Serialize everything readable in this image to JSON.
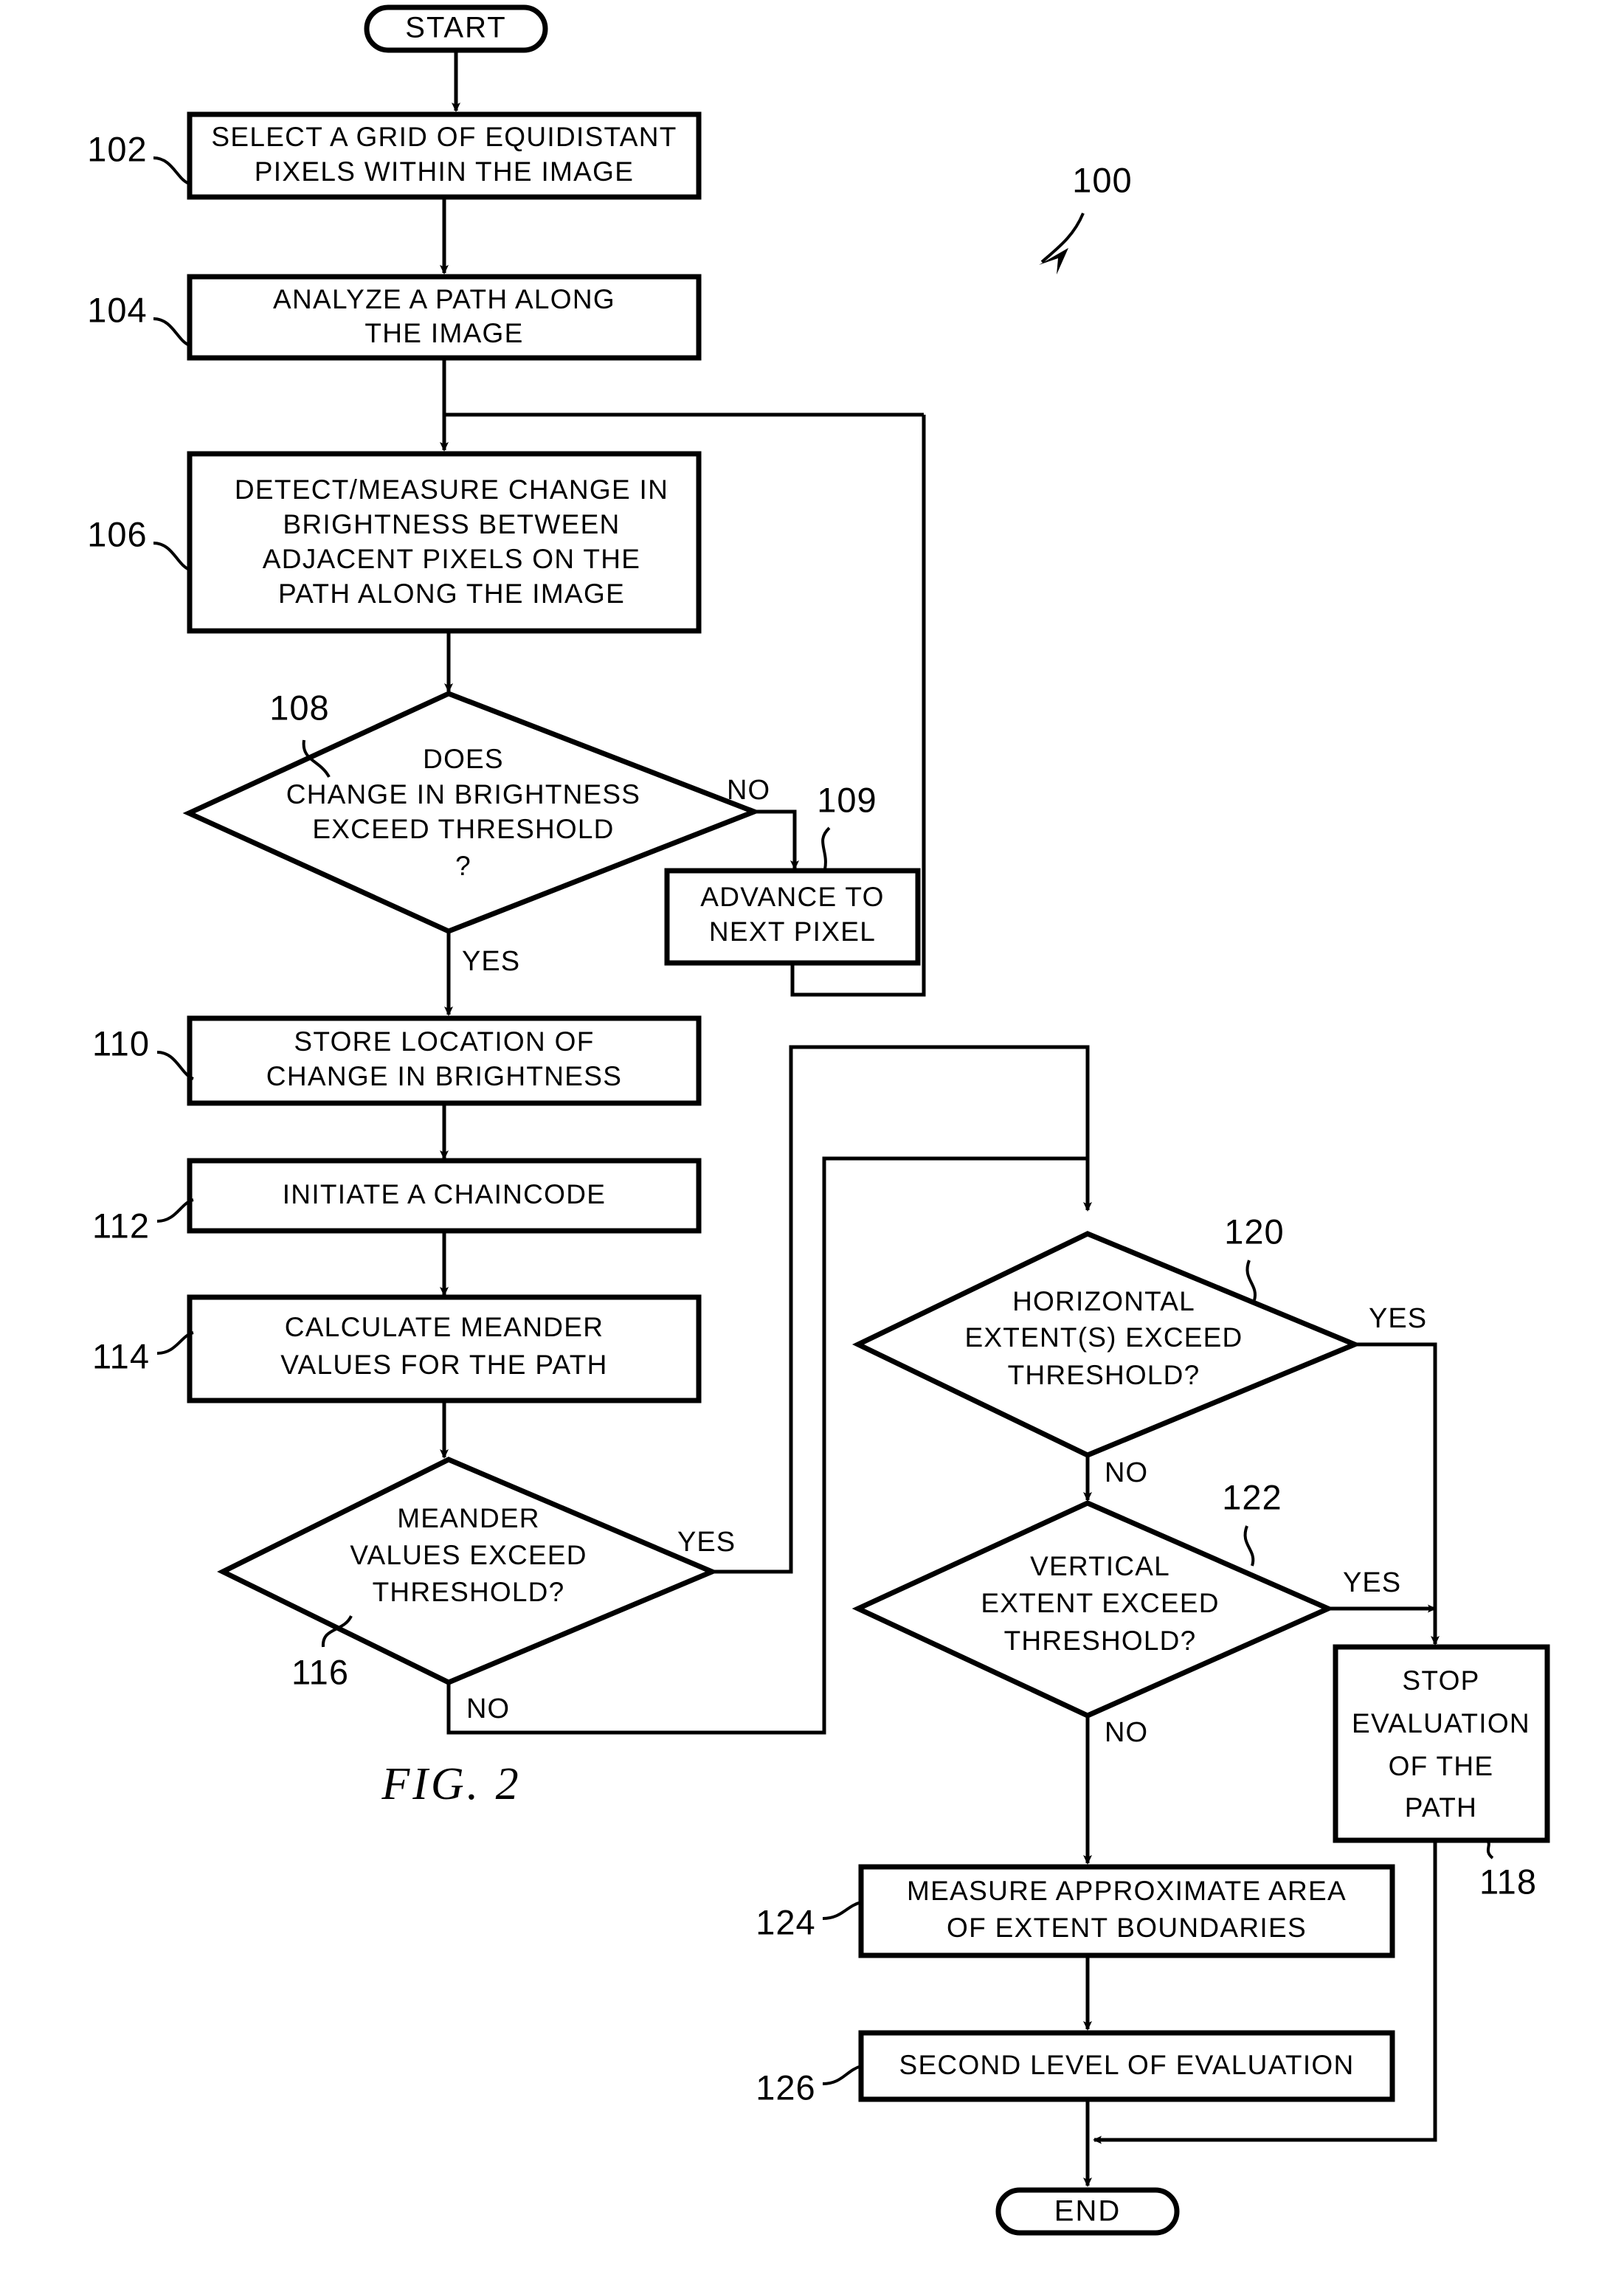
{
  "figure": {
    "caption": "FIG.  2",
    "overall_ref": "100"
  },
  "terminators": {
    "start": "START",
    "end": "END"
  },
  "nodes": [
    {
      "ref": "102",
      "type": "process",
      "lines": [
        "SELECT A GRID OF EQUIDISTANT",
        "PIXELS WITHIN THE IMAGE"
      ]
    },
    {
      "ref": "104",
      "type": "process",
      "lines": [
        "ANALYZE A PATH ALONG",
        "THE IMAGE"
      ]
    },
    {
      "ref": "106",
      "type": "process",
      "lines": [
        "DETECT/MEASURE CHANGE IN",
        "BRIGHTNESS BETWEEN",
        "ADJACENT PIXELS ON THE",
        "PATH ALONG THE IMAGE"
      ]
    },
    {
      "ref": "108",
      "type": "decision",
      "lines": [
        "DOES",
        "CHANGE IN BRIGHTNESS",
        "EXCEED THRESHOLD",
        "?"
      ]
    },
    {
      "ref": "109",
      "type": "process",
      "lines": [
        "ADVANCE TO",
        "NEXT PIXEL"
      ]
    },
    {
      "ref": "110",
      "type": "process",
      "lines": [
        "STORE LOCATION OF",
        "CHANGE IN BRIGHTNESS"
      ]
    },
    {
      "ref": "112",
      "type": "process",
      "lines": [
        "INITIATE A CHAINCODE"
      ]
    },
    {
      "ref": "114",
      "type": "process",
      "lines": [
        "CALCULATE MEANDER",
        "VALUES FOR THE PATH"
      ]
    },
    {
      "ref": "116",
      "type": "decision",
      "lines": [
        "MEANDER",
        "VALUES EXCEED",
        "THRESHOLD?"
      ]
    },
    {
      "ref": "120",
      "type": "decision",
      "lines": [
        "HORIZONTAL",
        "EXTENT(S) EXCEED",
        "THRESHOLD?"
      ]
    },
    {
      "ref": "122",
      "type": "decision",
      "lines": [
        "VERTICAL",
        "EXTENT EXCEED",
        "THRESHOLD?"
      ]
    },
    {
      "ref": "118",
      "type": "process",
      "lines": [
        "STOP",
        "EVALUATION",
        "OF THE",
        "PATH"
      ]
    },
    {
      "ref": "124",
      "type": "process",
      "lines": [
        "MEASURE APPROXIMATE AREA",
        "OF EXTENT BOUNDARIES"
      ]
    },
    {
      "ref": "126",
      "type": "process",
      "lines": [
        "SECOND LEVEL OF EVALUATION"
      ]
    }
  ],
  "edge_labels": {
    "d108_no": "NO",
    "d108_yes": "YES",
    "d116_yes": "YES",
    "d116_no": "NO",
    "d120_yes": "YES",
    "d120_no": "NO",
    "d122_yes": "YES",
    "d122_no": "NO"
  },
  "colors": {
    "ink": "#000000",
    "paper": "#ffffff"
  }
}
